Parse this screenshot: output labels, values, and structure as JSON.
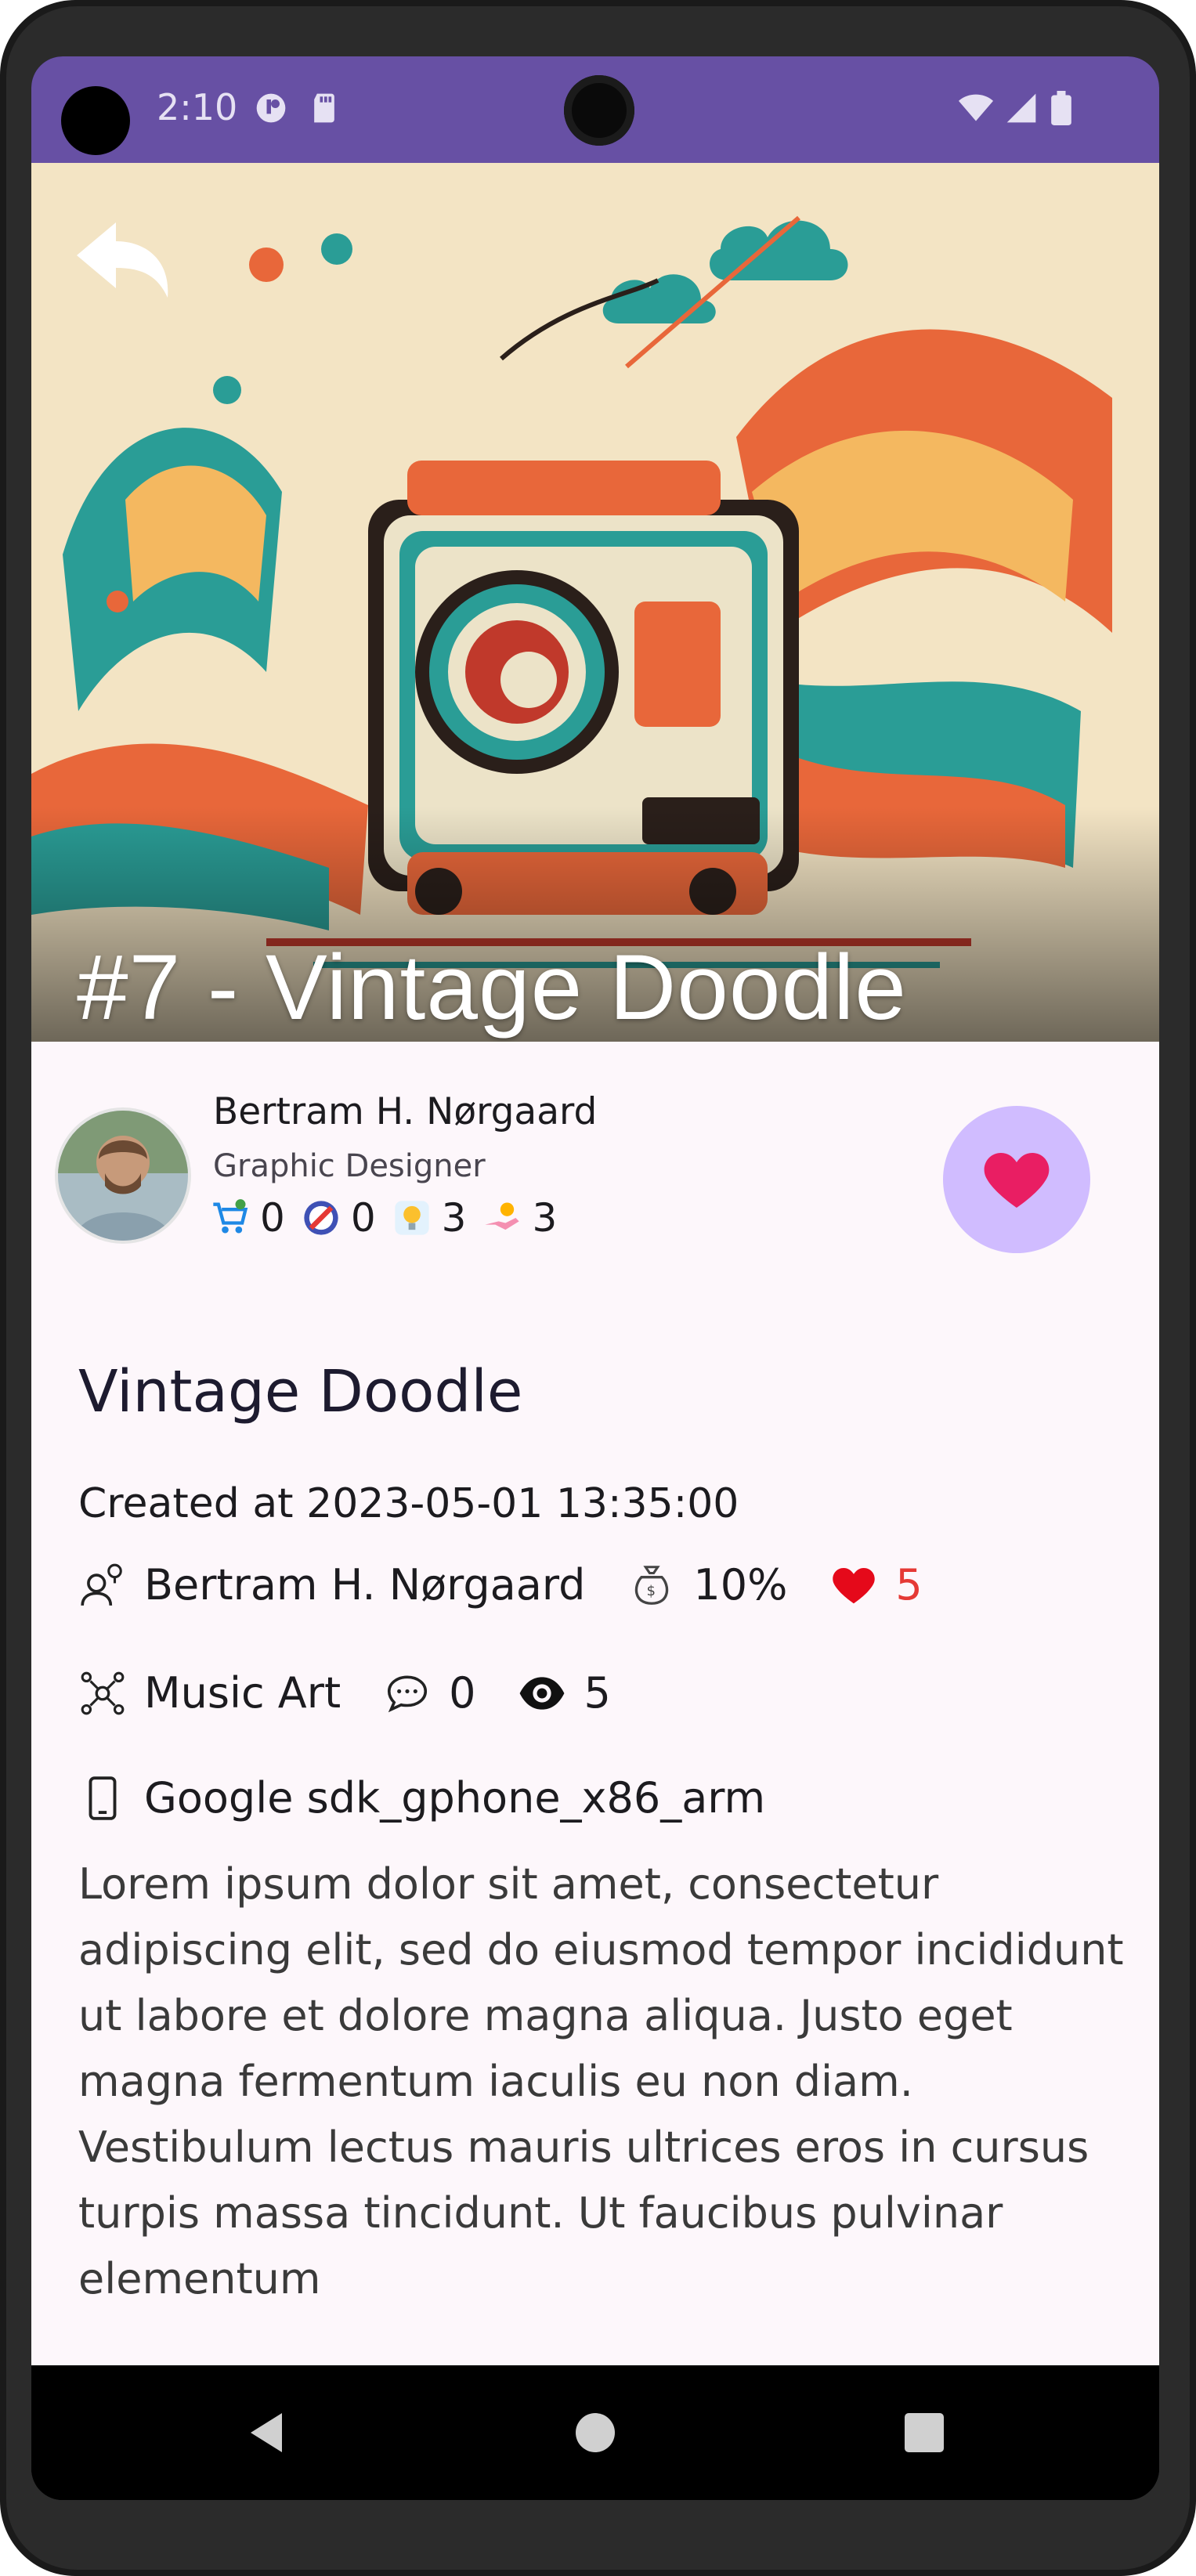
{
  "status_bar": {
    "time": "2:10"
  },
  "hero": {
    "title": "#7 - Vintage Doodle"
  },
  "author": {
    "name": "Bertram H. Nørgaard",
    "role": "Graphic Designer",
    "stats": [
      "0",
      "0",
      "3",
      "3"
    ]
  },
  "artwork": {
    "title": "Vintage Doodle",
    "created": "Created at 2023-05-01 13:35:00",
    "artist": "Bertram H. Nørgaard",
    "royalty": "10%",
    "likes": "5",
    "category": "Music Art",
    "comments": "0",
    "views": "5",
    "device": "Google sdk_gphone_x86_arm",
    "description": "Lorem ipsum dolor sit amet, consectetur adipiscing elit, sed do eiusmod tempor incididunt ut labore et dolore magna aliqua. Justo eget magna fermentum iaculis eu non diam. Vestibulum lectus mauris ultrices eros in cursus turpis massa tincidunt. Ut faucibus pulvinar elementum"
  },
  "colors": {
    "status_bar": "#6750a4",
    "favorite_button": "#d0bcff",
    "heart": "#e91e63",
    "likes": "#e53935",
    "background": "#fdf7fb"
  }
}
